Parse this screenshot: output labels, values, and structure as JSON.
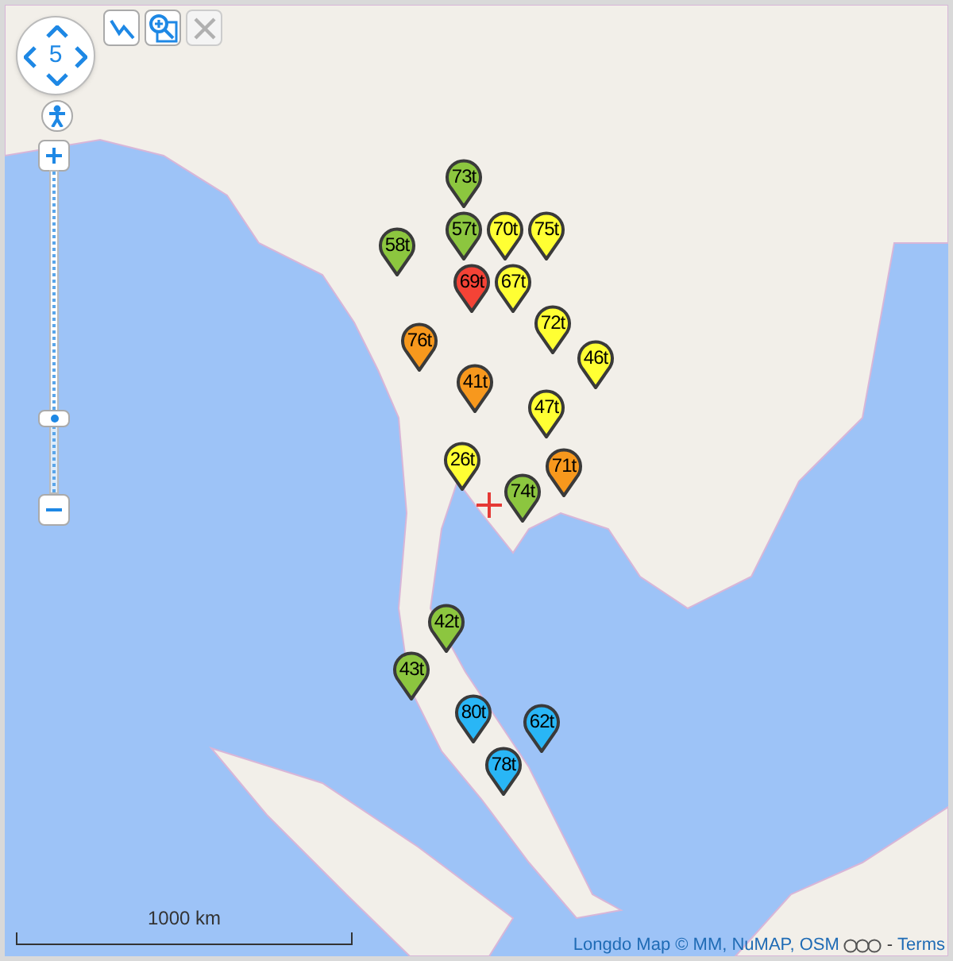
{
  "map": {
    "zoom_label": "5",
    "zoom_slider": {
      "level": 0.22
    },
    "tools": [
      {
        "kind": "line",
        "disabled": false
      },
      {
        "kind": "zoom_box",
        "disabled": false
      },
      {
        "kind": "clear",
        "disabled": true
      }
    ],
    "markers": [
      {
        "label": "73t",
        "color": "#8cc63f"
      },
      {
        "label": "57t",
        "color": "#8cc63f"
      },
      {
        "label": "58t",
        "color": "#8cc63f"
      },
      {
        "label": "70t",
        "color": "#ffff33"
      },
      {
        "label": "75t",
        "color": "#ffff33"
      },
      {
        "label": "67t",
        "color": "#ffff33"
      },
      {
        "label": "69t",
        "color": "#f44336"
      },
      {
        "label": "72t",
        "color": "#ffff33"
      },
      {
        "label": "76t",
        "color": "#f7981d"
      },
      {
        "label": "46t",
        "color": "#ffff33"
      },
      {
        "label": "41t",
        "color": "#f7981d"
      },
      {
        "label": "47t",
        "color": "#ffff33"
      },
      {
        "label": "71t",
        "color": "#f7981d"
      },
      {
        "label": "26t",
        "color": "#ffff33"
      },
      {
        "label": "74t",
        "color": "#8cc63f"
      },
      {
        "label": "42t",
        "color": "#8cc63f"
      },
      {
        "label": "43t",
        "color": "#8cc63f"
      },
      {
        "label": "80t",
        "color": "#29b6f6"
      },
      {
        "label": "62t",
        "color": "#29b6f6"
      },
      {
        "label": "78t",
        "color": "#29b6f6"
      }
    ],
    "scale": "1000 km",
    "attribution": {
      "source": "Longdo Map © MM, NuMAP, OSM",
      "separator": "-",
      "terms": "Terms"
    }
  }
}
